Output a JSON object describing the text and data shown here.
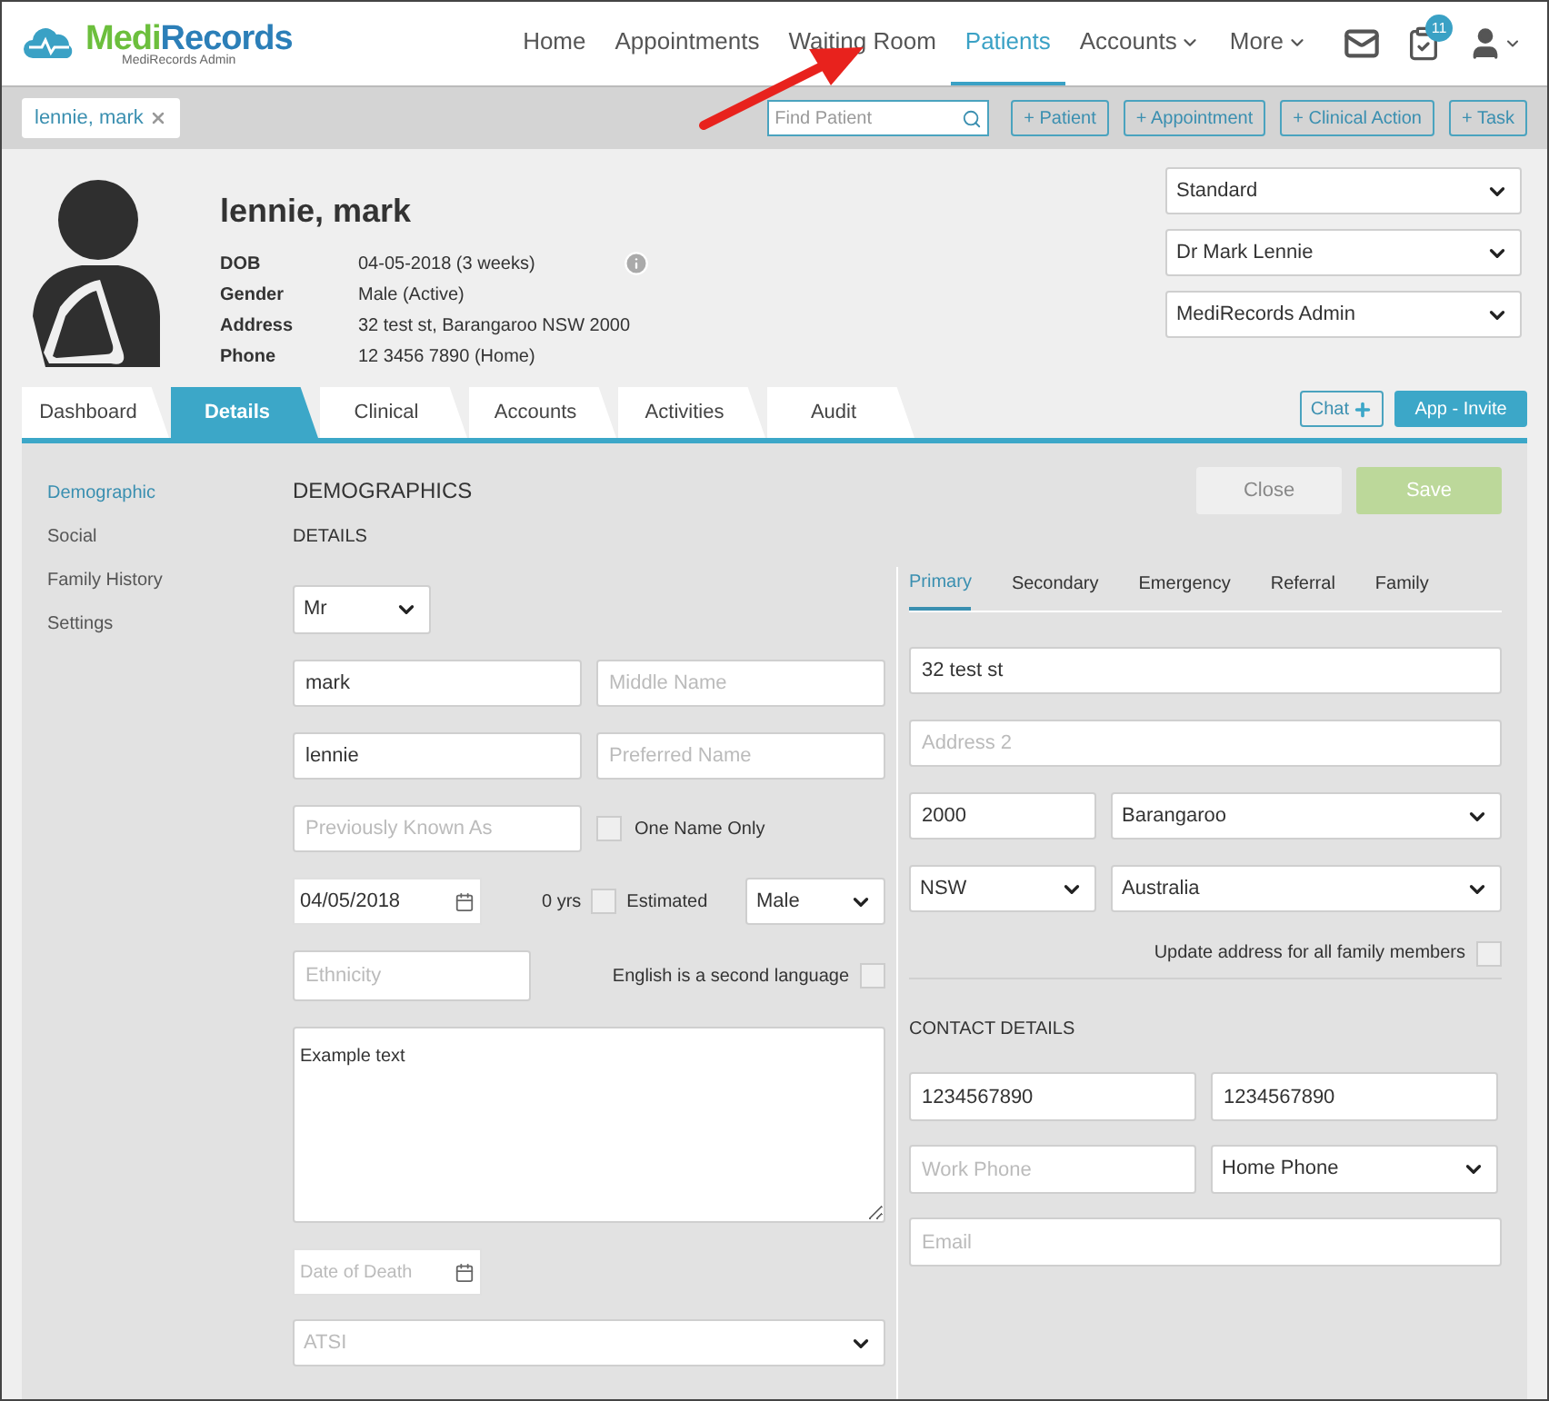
{
  "brand": {
    "name_a": "Medi",
    "name_b": "Records",
    "subtitle": "MediRecords Admin"
  },
  "nav": [
    {
      "label": "Home",
      "selected": false,
      "dropdown": false
    },
    {
      "label": "Appointments",
      "selected": false,
      "dropdown": false
    },
    {
      "label": "Waiting Room",
      "selected": false,
      "dropdown": false
    },
    {
      "label": "Patients",
      "selected": true,
      "dropdown": false
    },
    {
      "label": "Accounts",
      "selected": false,
      "dropdown": true
    },
    {
      "label": "More",
      "selected": false,
      "dropdown": true
    }
  ],
  "tasks_badge": "11",
  "patient_chip": "lennie, mark",
  "search": {
    "placeholder": "Find Patient"
  },
  "actions": [
    "+ Patient",
    "+ Appointment",
    "+ Clinical Action",
    "+ Task"
  ],
  "patient": {
    "name": "lennie, mark",
    "fields": [
      {
        "label": "DOB",
        "value": "04-05-2018 (3 weeks)"
      },
      {
        "label": "Gender",
        "value": "Male (Active)"
      },
      {
        "label": "Address",
        "value": "32 test st, Barangaroo NSW 2000"
      },
      {
        "label": "Phone",
        "value": "12 3456 7890 (Home)"
      }
    ]
  },
  "selectors": [
    "Standard",
    "Dr Mark Lennie",
    "MediRecords Admin"
  ],
  "tabs": [
    {
      "label": "Dashboard",
      "selected": false
    },
    {
      "label": "Details",
      "selected": true
    },
    {
      "label": "Clinical",
      "selected": false
    },
    {
      "label": "Accounts",
      "selected": false
    },
    {
      "label": "Activities",
      "selected": false
    },
    {
      "label": "Audit",
      "selected": false
    }
  ],
  "chat_button": "Chat",
  "invite_button": "App - Invite",
  "sidebar": [
    {
      "label": "Demographic",
      "selected": true
    },
    {
      "label": "Social",
      "selected": false
    },
    {
      "label": "Family History",
      "selected": false
    },
    {
      "label": "Settings",
      "selected": false
    }
  ],
  "section_title": "DEMOGRAPHICS",
  "close_button": "Close",
  "save_button": "Save",
  "details_heading": "DETAILS",
  "form": {
    "title": "Mr",
    "first_name": "mark",
    "middle_name": {
      "placeholder": "Middle Name"
    },
    "last_name": "lennie",
    "preferred_name": {
      "placeholder": "Preferred Name"
    },
    "previously_known_as": {
      "placeholder": "Previously Known As"
    },
    "one_name_only": {
      "label": "One Name Only",
      "checked": false
    },
    "dob": "04/05/2018",
    "age": "0 yrs",
    "estimated": {
      "label": "Estimated",
      "checked": false
    },
    "gender": "Male",
    "ethnicity": {
      "placeholder": "Ethnicity"
    },
    "second_language": {
      "label": "English is a second language",
      "checked": false
    },
    "notes": "Example text",
    "date_of_death": {
      "placeholder": "Date of Death"
    },
    "atsi": {
      "placeholder": "ATSI"
    }
  },
  "address_tabs": [
    {
      "label": "Primary",
      "selected": true
    },
    {
      "label": "Secondary",
      "selected": false
    },
    {
      "label": "Emergency",
      "selected": false
    },
    {
      "label": "Referral",
      "selected": false
    },
    {
      "label": "Family",
      "selected": false
    }
  ],
  "address": {
    "line1": "32 test st",
    "line2": {
      "placeholder": "Address 2"
    },
    "postcode": "2000",
    "suburb": "Barangaroo",
    "state": "NSW",
    "country": "Australia",
    "update_family": {
      "label": "Update address for all family members",
      "checked": false
    }
  },
  "contact": {
    "heading": "CONTACT DETAILS",
    "phone_1": "1234567890",
    "phone_2": "1234567890",
    "work_phone": {
      "placeholder": "Work Phone"
    },
    "phone_type": "Home Phone",
    "email": {
      "placeholder": "Email"
    }
  }
}
